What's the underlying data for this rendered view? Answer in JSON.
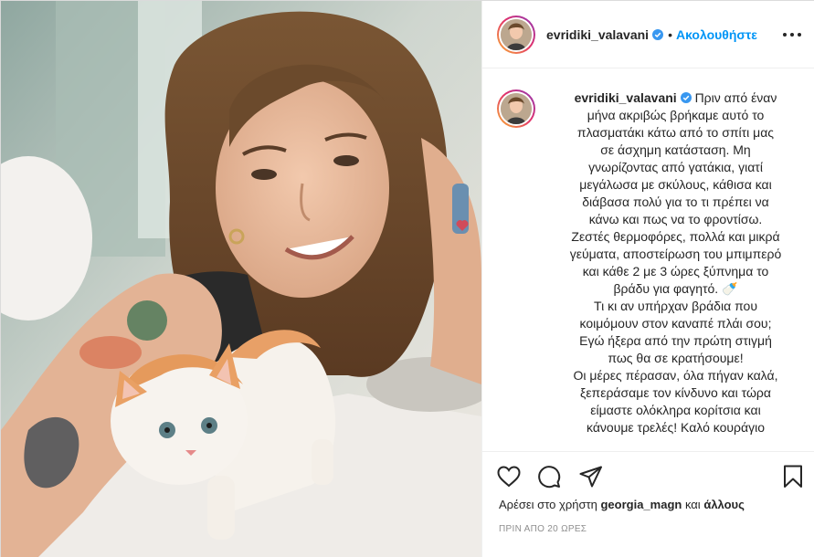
{
  "post": {
    "username": "evridiki_valavani",
    "follow_label": "Ακολουθήστε",
    "dot": "•"
  },
  "caption": {
    "username": "evridiki_valavani",
    "lines": [
      "Πριν από έναν",
      "μήνα ακριβώς βρήκαμε αυτό το",
      "πλασματάκι κάτω από το σπίτι μας",
      "σε άσχημη κατάσταση. Μη",
      "γνωρίζοντας από γατάκια, γιατί",
      "μεγάλωσα με σκύλους, κάθισα και",
      "διάβασα πολύ για το τι πρέπει να",
      "κάνω και πως να το φροντίσω.",
      "Ζεστές θερμοφόρες, πολλά και μικρά",
      "γεύματα, αποστείρωση του μπιμπερό",
      "και κάθε 2 με 3 ώρες ξύπνημα το",
      "βράδυ για φαγητό. 🍼",
      "Τι κι αν υπήρχαν βράδια που",
      "κοιμόμουν στον καναπέ πλάι σου;",
      "Εγώ ήξερα από την πρώτη στιγμή",
      "πως θα σε κρατήσουμε!",
      "Οι μέρες πέρασαν, όλα πήγαν καλά,",
      "ξεπεράσαμε τον κίνδυνο και τώρα",
      "είμαστε ολόκληρα κορίτσια και",
      "κάνουμε τρελές! Καλό κουράγιο"
    ]
  },
  "likes": {
    "prefix": "Αρέσει στο χρήστη",
    "user": "georgia_magn",
    "middle": "και",
    "others": "άλλους"
  },
  "timestamp": "ΠΡΙΝ ΑΠΟ 20 ΩΡΕΣ",
  "icons": {
    "like": "heart-icon",
    "comment": "comment-icon",
    "share": "send-icon",
    "save": "bookmark-icon",
    "more": "more-options-icon",
    "verified": "verified-badge-icon"
  },
  "colors": {
    "accent": "#0095f6",
    "verified": "#3897f0",
    "muted": "#8e8e8e",
    "text": "#262626"
  }
}
